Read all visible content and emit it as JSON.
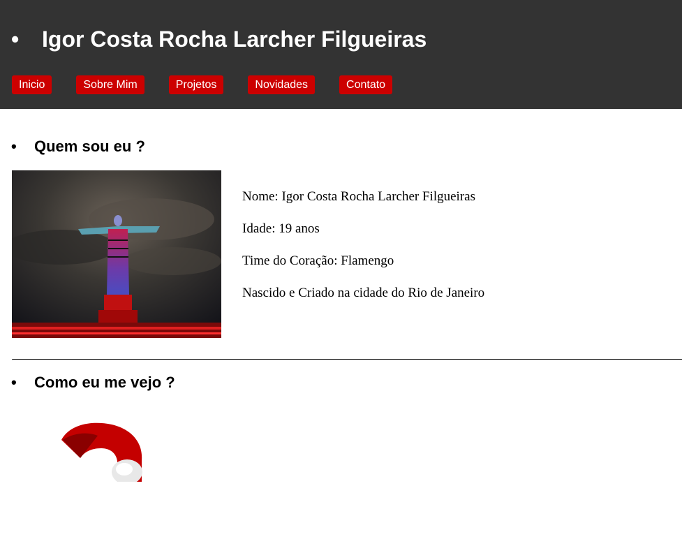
{
  "header": {
    "title": "Igor Costa Rocha Larcher Filgueiras",
    "bullet": "•"
  },
  "nav": {
    "items": [
      "Inicio",
      "Sobre Mim",
      "Projetos",
      "Novidades",
      "Contato"
    ]
  },
  "about": {
    "bullet": "•",
    "title": "Quem sou eu ?",
    "lines": [
      "Nome: Igor Costa Rocha Larcher Filgueiras",
      "Idade: 19 anos",
      "Time do Coração: Flamengo",
      "Nascido e Criado na cidade do Rio de Janeiro"
    ]
  },
  "self_view": {
    "bullet": "•",
    "title": "Como eu me vejo ?"
  },
  "colors": {
    "header_bg": "#333333",
    "nav_button_bg": "#cc0000",
    "nav_text": "#ffffff"
  }
}
